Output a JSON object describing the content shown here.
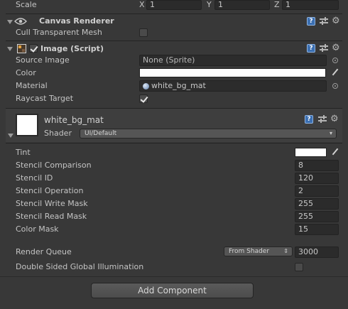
{
  "scale_row": {
    "label": "Scale",
    "x_label": "X",
    "x_value": "1",
    "y_label": "Y",
    "y_value": "1",
    "z_label": "Z",
    "z_value": "1"
  },
  "canvas_renderer": {
    "title": "Canvas Renderer",
    "cull_label": "Cull Transparent Mesh",
    "cull_checked": false
  },
  "image_component": {
    "title": "Image (Script)",
    "enabled": true,
    "source_image_label": "Source Image",
    "source_image_value": "None (Sprite)",
    "color_label": "Color",
    "color_value": "#ffffff",
    "material_label": "Material",
    "material_value": "white_bg_mat",
    "raycast_label": "Raycast Target",
    "raycast_checked": true
  },
  "material_panel": {
    "name": "white_bg_mat",
    "shader_label": "Shader",
    "shader_value": "UI/Default",
    "properties": [
      {
        "label": "Tint",
        "type": "color",
        "value": "#ffffff"
      },
      {
        "label": "Stencil Comparison",
        "type": "number",
        "value": "8"
      },
      {
        "label": "Stencil ID",
        "type": "number",
        "value": "120"
      },
      {
        "label": "Stencil Operation",
        "type": "number",
        "value": "2"
      },
      {
        "label": "Stencil Write Mask",
        "type": "number",
        "value": "255"
      },
      {
        "label": "Stencil Read Mask",
        "type": "number",
        "value": "255"
      },
      {
        "label": "Color Mask",
        "type": "number",
        "value": "15"
      }
    ],
    "render_queue_label": "Render Queue",
    "render_queue_mode": "From Shader",
    "render_queue_value": "3000",
    "double_sided_label": "Double Sided Global Illumination",
    "double_sided_checked": false
  },
  "add_component_label": "Add Component",
  "colors": {
    "background": "#383838",
    "field": "#2e2e2e",
    "header": "#3e3e3e",
    "help_blue": "#3b6fb2"
  }
}
